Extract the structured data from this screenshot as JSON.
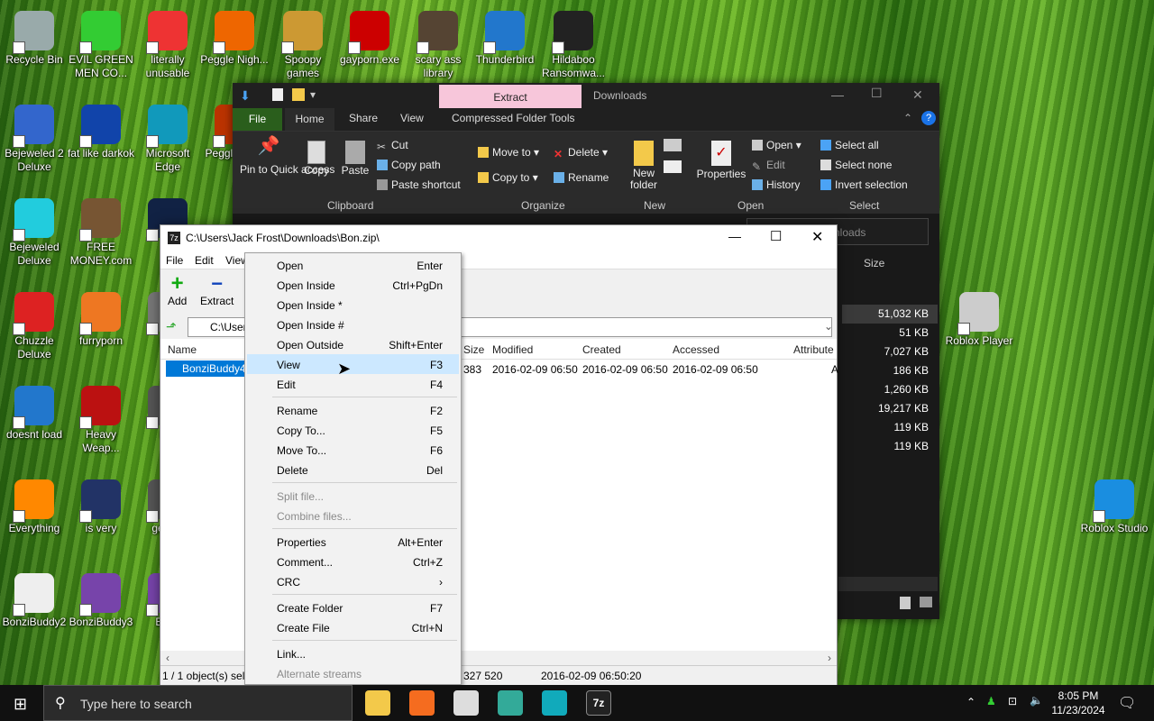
{
  "desktop": {
    "icons": [
      {
        "label": "Recycle Bin",
        "color": "#9aa"
      },
      {
        "label": "EVIL GREEN MEN CO...",
        "color": "#3c3"
      },
      {
        "label": "literally unusable",
        "color": "#e33"
      },
      {
        "label": "Peggle Nigh...",
        "color": "#e60"
      },
      {
        "label": "Spoopy games",
        "color": "#c93"
      },
      {
        "label": "gayporn.exe",
        "color": "#c00"
      },
      {
        "label": "scary ass library",
        "color": "#543"
      },
      {
        "label": "Thunderbird",
        "color": "#27c"
      },
      {
        "label": "Hildaboo Ransomwa...",
        "color": "#222"
      },
      {
        "label": "Bejeweled 2 Deluxe",
        "color": "#36c"
      },
      {
        "label": "fat like darkok",
        "color": "#14a"
      },
      {
        "label": "Microsoft Edge",
        "color": "#19b"
      },
      {
        "label": "Peggl of Wa",
        "color": "#b30"
      },
      {
        "label": "Bejeweled Deluxe",
        "color": "#2cd"
      },
      {
        "label": "FREE MONEY.com",
        "color": "#753"
      },
      {
        "label": "ne",
        "color": "#124"
      },
      {
        "label": "Chuzzle Deluxe",
        "color": "#d22"
      },
      {
        "label": "furryporn",
        "color": "#e72"
      },
      {
        "label": "Not",
        "color": "#777"
      },
      {
        "label": "doesnt load",
        "color": "#27c"
      },
      {
        "label": "Heavy Weap...",
        "color": "#b11"
      },
      {
        "label": "P P",
        "color": "#555"
      },
      {
        "label": "Everything",
        "color": "#f80"
      },
      {
        "label": "is very",
        "color": "#236"
      },
      {
        "label": "get I D",
        "color": "#555"
      },
      {
        "label": "BonziBuddy2",
        "color": "#eee"
      },
      {
        "label": "BonziBuddy3",
        "color": "#74a"
      },
      {
        "label": "Bonz",
        "color": "#74a"
      },
      {
        "label": "Roblox Player",
        "color": "#ccc"
      },
      {
        "label": "Roblox Studio",
        "color": "#1a8ee0"
      }
    ]
  },
  "explorer": {
    "title": "Downloads",
    "contextual_tab": "Extract",
    "tabs": [
      "File",
      "Home",
      "Share",
      "View",
      "Compressed Folder Tools"
    ],
    "ribbon": {
      "clipboard": {
        "group": "Clipboard",
        "pin": "Pin to Quick access",
        "copy": "Copy",
        "paste": "Paste",
        "cut": "Cut",
        "copy_path": "Copy path",
        "paste_shortcut": "Paste shortcut"
      },
      "organize": {
        "group": "Organize",
        "move_to": "Move to",
        "copy_to": "Copy to",
        "delete": "Delete",
        "rename": "Rename"
      },
      "new": {
        "group": "New",
        "new_folder": "New folder"
      },
      "open": {
        "group": "Open",
        "properties": "Properties",
        "open": "Open",
        "edit": "Edit",
        "history": "History"
      },
      "select": {
        "group": "Select",
        "select_all": "Select all",
        "select_none": "Select none",
        "invert": "Invert selection"
      }
    },
    "search_placeholder": "nloads",
    "size_header": "Size",
    "sizes": [
      "51,032 KB",
      "51 KB",
      "7,027 KB",
      "186 KB",
      "1,260 KB",
      "19,217 KB",
      "119 KB",
      "119 KB"
    ]
  },
  "sevenzip": {
    "title": "C:\\Users\\Jack Frost\\Downloads\\Bon.zip\\",
    "menu": [
      "File",
      "Edit",
      "View"
    ],
    "toolbar": {
      "add": "Add",
      "extract": "Extract"
    },
    "address": "C:\\User",
    "columns": {
      "name": "Name",
      "size": "Size",
      "modified": "Modified",
      "created": "Created",
      "accessed": "Accessed",
      "attributes": "Attribute"
    },
    "file": {
      "name": "BonziBuddy4",
      "size": "383",
      "modified": "2016-02-09 06:50",
      "created": "2016-02-09 06:50",
      "accessed": "2016-02-09 06:50",
      "attributes": "A"
    },
    "status": {
      "selection": "1 / 1 object(s) sele",
      "size": "327 520",
      "date": "2016-02-09 06:50:20"
    }
  },
  "context_menu": {
    "items": [
      {
        "label": "Open",
        "key": "Enter"
      },
      {
        "label": "Open Inside",
        "key": "Ctrl+PgDn"
      },
      {
        "label": "Open Inside *",
        "key": ""
      },
      {
        "label": "Open Inside #",
        "key": ""
      },
      {
        "label": "Open Outside",
        "key": "Shift+Enter"
      },
      {
        "label": "View",
        "key": "F3"
      },
      {
        "label": "Edit",
        "key": "F4"
      },
      {
        "label": "Rename",
        "key": "F2"
      },
      {
        "label": "Copy To...",
        "key": "F5"
      },
      {
        "label": "Move To...",
        "key": "F6"
      },
      {
        "label": "Delete",
        "key": "Del"
      },
      {
        "label": "Split file...",
        "key": ""
      },
      {
        "label": "Combine files...",
        "key": ""
      },
      {
        "label": "Properties",
        "key": "Alt+Enter"
      },
      {
        "label": "Comment...",
        "key": "Ctrl+Z"
      },
      {
        "label": "CRC",
        "key": "›"
      },
      {
        "label": "Create Folder",
        "key": "F7"
      },
      {
        "label": "Create File",
        "key": "Ctrl+N"
      },
      {
        "label": "Link...",
        "key": ""
      },
      {
        "label": "Alternate streams",
        "key": ""
      }
    ]
  },
  "taskbar": {
    "search_placeholder": "Type here to search",
    "time": "8:05 PM",
    "date": "11/23/2024",
    "apps": [
      "File Explorer",
      "Firefox",
      "Rocket",
      "Chrome",
      "App",
      "7z"
    ]
  },
  "colors": {
    "selection": "#cce8ff",
    "explorer_bg": "#191919",
    "extract_tab": "#f7c6da",
    "file_tab": "#2a5e1c"
  }
}
